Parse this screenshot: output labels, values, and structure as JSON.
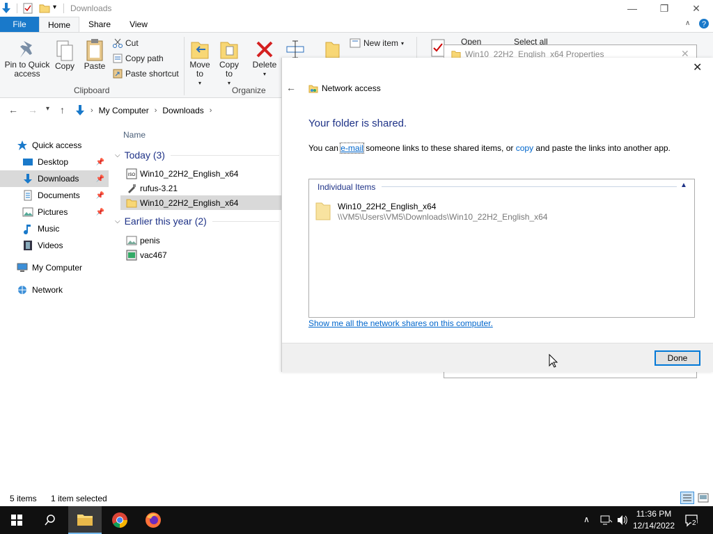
{
  "window": {
    "title": "Downloads"
  },
  "ribbon": {
    "tabs": [
      {
        "label": "File"
      },
      {
        "label": "Home"
      },
      {
        "label": "Share"
      },
      {
        "label": "View"
      }
    ],
    "clipboard": {
      "pin_label": "Pin to Quick access",
      "copy_label": "Copy",
      "paste_label": "Paste",
      "cut_label": "Cut",
      "copy_path_label": "Copy path",
      "paste_shortcut_label": "Paste shortcut",
      "group_label": "Clipboard"
    },
    "organize": {
      "move_to_label": "Move to",
      "copy_to_label": "Copy to",
      "delete_label": "Delete",
      "group_label": "Organize"
    },
    "new": {
      "new_item_label": "New item"
    },
    "open": {
      "open_label": "Open",
      "select_all_label": "Select all"
    }
  },
  "address": {
    "crumbs": [
      "My Computer",
      "Downloads"
    ]
  },
  "navpane": {
    "items": [
      {
        "label": "Quick access",
        "pinned": false
      },
      {
        "label": "Desktop",
        "pinned": true
      },
      {
        "label": "Downloads",
        "pinned": true
      },
      {
        "label": "Documents",
        "pinned": true
      },
      {
        "label": "Pictures",
        "pinned": true
      },
      {
        "label": "Music",
        "pinned": false
      },
      {
        "label": "Videos",
        "pinned": false
      },
      {
        "label": "My Computer",
        "pinned": false
      },
      {
        "label": "Network",
        "pinned": false
      }
    ]
  },
  "filelist": {
    "column_name": "Name",
    "groups": [
      {
        "heading": "Today (3)",
        "files": [
          {
            "name": "Win10_22H2_English_x64",
            "icon": "iso-icon"
          },
          {
            "name": "rufus-3.21",
            "icon": "usb-app-icon"
          },
          {
            "name": "Win10_22H2_English_x64",
            "icon": "folder-icon"
          }
        ]
      },
      {
        "heading": "Earlier this year (2)",
        "files": [
          {
            "name": "penis",
            "icon": "image-file-icon"
          },
          {
            "name": "vac467",
            "icon": "executable-icon"
          }
        ]
      }
    ]
  },
  "statusbar": {
    "item_count": "5 items",
    "selection": "1 item selected"
  },
  "properties_dialog": {
    "title": "Win10_22H2_English_x64 Properties"
  },
  "network_dialog": {
    "title": "Network access",
    "heading": "Your folder is shared.",
    "body_prefix": "You can ",
    "email_link": "e-mail",
    "body_middle": " someone links to these shared items, or ",
    "copy_link": "copy",
    "body_suffix": " and paste the links into another app.",
    "box_title": "Individual Items",
    "shared_item": {
      "name": "Win10_22H2_English_x64",
      "path": "\\\\VM5\\Users\\VM5\\Downloads\\Win10_22H2_English_x64"
    },
    "shares_link": "Show me all the network shares on this computer.",
    "done_label": "Done"
  },
  "taskbar": {
    "time": "11:36 PM",
    "date": "12/14/2022",
    "notification_count": "2"
  }
}
